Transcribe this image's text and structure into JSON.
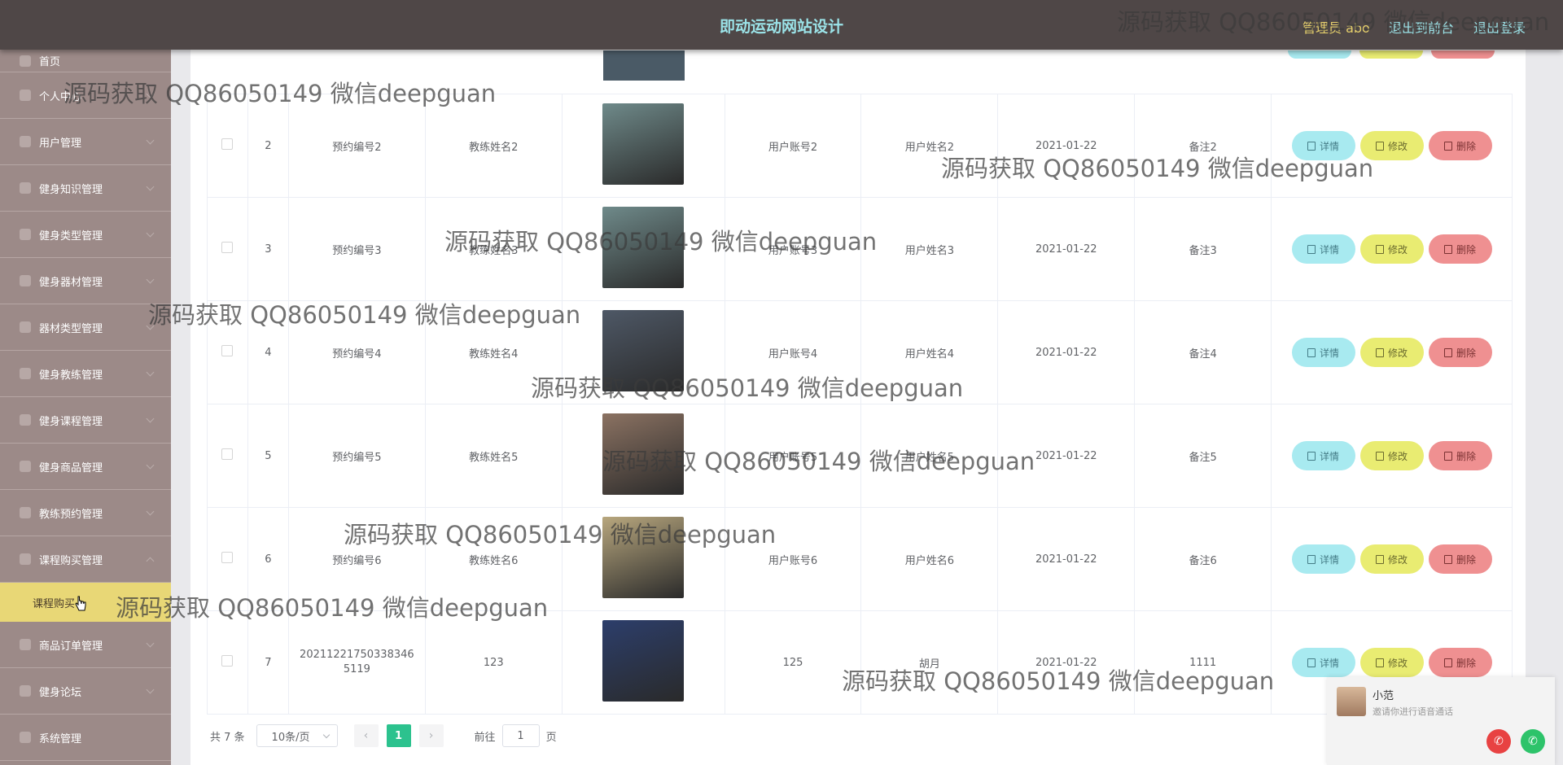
{
  "header": {
    "title": "即动运动网站设计",
    "user_label": "管理员 abo",
    "back_link": "退出到前台",
    "logout_link": "退出登录"
  },
  "sidebar": {
    "items": [
      {
        "label": "首页",
        "icon": "home-icon"
      },
      {
        "label": "个人中心",
        "icon": "user-icon"
      },
      {
        "label": "用户管理",
        "icon": "users-icon"
      },
      {
        "label": "健身知识管理",
        "icon": "book-icon"
      },
      {
        "label": "健身类型管理",
        "icon": "tag-icon"
      },
      {
        "label": "健身器材管理",
        "icon": "dumbbell-icon"
      },
      {
        "label": "器材类型管理",
        "icon": "list-icon"
      },
      {
        "label": "健身教练管理",
        "icon": "coach-icon"
      },
      {
        "label": "健身课程管理",
        "icon": "course-icon"
      },
      {
        "label": "健身商品管理",
        "icon": "grid-icon"
      },
      {
        "label": "教练预约管理",
        "icon": "calendar-icon"
      },
      {
        "label": "课程购买管理",
        "icon": "cart-icon"
      }
    ],
    "active_sub": "课程购买",
    "items_after": [
      {
        "label": "商品订单管理",
        "icon": "order-icon"
      },
      {
        "label": "健身论坛",
        "icon": "forum-icon"
      },
      {
        "label": "系统管理",
        "icon": "settings-icon"
      }
    ]
  },
  "table": {
    "rows": [
      {
        "index": "2",
        "booking_no": "预约编号2",
        "coach": "教练姓名2",
        "account": "用户账号2",
        "username": "用户姓名2",
        "date": "2021-01-22",
        "note": "备注2",
        "photo": "#6f8a8a"
      },
      {
        "index": "3",
        "booking_no": "预约编号3",
        "coach": "教练姓名3",
        "account": "用户账号3",
        "username": "用户姓名3",
        "date": "2021-01-22",
        "note": "备注3",
        "photo": "#6f8a8a"
      },
      {
        "index": "4",
        "booking_no": "预约编号4",
        "coach": "教练姓名4",
        "account": "用户账号4",
        "username": "用户姓名4",
        "date": "2021-01-22",
        "note": "备注4",
        "photo": "#4e5866"
      },
      {
        "index": "5",
        "booking_no": "预约编号5",
        "coach": "教练姓名5",
        "account": "用户账号5",
        "username": "用户姓名5",
        "date": "2021-01-22",
        "note": "备注5",
        "photo": "#8b7262"
      },
      {
        "index": "6",
        "booking_no": "预约编号6",
        "coach": "教练姓名6",
        "account": "用户账号6",
        "username": "用户姓名6",
        "date": "2021-01-22",
        "note": "备注6",
        "photo": "#b8a77e"
      },
      {
        "index": "7",
        "booking_no": "202112217503383465119",
        "coach": "123",
        "account": "125",
        "username": "胡月",
        "date": "2021-01-22",
        "note": "1111",
        "photo": "#2c3e6b"
      }
    ],
    "actions": {
      "detail": "详情",
      "edit": "修改",
      "delete": "删除"
    }
  },
  "pagination": {
    "total": "共 7 条",
    "page_size": "10条/页",
    "current_page": "1",
    "goto_prefix": "前往",
    "goto_value": "1",
    "goto_suffix": "页"
  },
  "call_widget": {
    "name": "小范",
    "message": "邀请你进行语音通话"
  },
  "watermark": "源码获取 QQ86050149 微信deepguan",
  "colors": {
    "topbar": "#4f4747",
    "sidebar": "#9c8a88",
    "active_sub": "#e8d776",
    "detail": "#a8eaf0",
    "edit": "#e9ec72",
    "delete": "#ef9091",
    "page_active": "#2cc28e"
  }
}
